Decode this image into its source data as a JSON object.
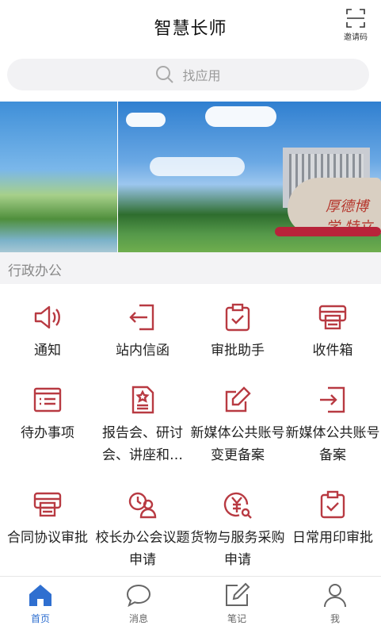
{
  "header": {
    "title": "智慧长师",
    "invite_label": "邀请码"
  },
  "search": {
    "placeholder": "找应用"
  },
  "banner": {
    "rock_text": "厚德博学 特立"
  },
  "section": {
    "title": "行政办公"
  },
  "accent_color": "#b83a42",
  "apps": [
    {
      "label": "通知",
      "icon": "speaker-icon"
    },
    {
      "label": "站内信函",
      "icon": "login-arrow-icon"
    },
    {
      "label": "审批助手",
      "icon": "clipboard-check-icon"
    },
    {
      "label": "收件箱",
      "icon": "printer-icon"
    },
    {
      "label": "待办事项",
      "icon": "list-icon"
    },
    {
      "label": "报告会、研讨会、讲座和…",
      "icon": "document-star-icon"
    },
    {
      "label": "新媒体公共账号变更备案",
      "icon": "edit-icon"
    },
    {
      "label": "新媒体公共账号备案",
      "icon": "login-arrow-icon"
    },
    {
      "label": "合同协议审批",
      "icon": "printer-icon"
    },
    {
      "label": "校长办公会议题申请",
      "icon": "user-clock-icon"
    },
    {
      "label": "货物与服务采购申请",
      "icon": "yuan-search-icon"
    },
    {
      "label": "日常用印审批",
      "icon": "clipboard-check-icon"
    }
  ],
  "tabs": [
    {
      "label": "首页",
      "icon": "home-icon",
      "active": true
    },
    {
      "label": "消息",
      "icon": "message-icon",
      "active": false
    },
    {
      "label": "笔记",
      "icon": "notes-icon",
      "active": false
    },
    {
      "label": "我",
      "icon": "user-icon",
      "active": false
    }
  ],
  "tab_active_color": "#2f6fd0"
}
